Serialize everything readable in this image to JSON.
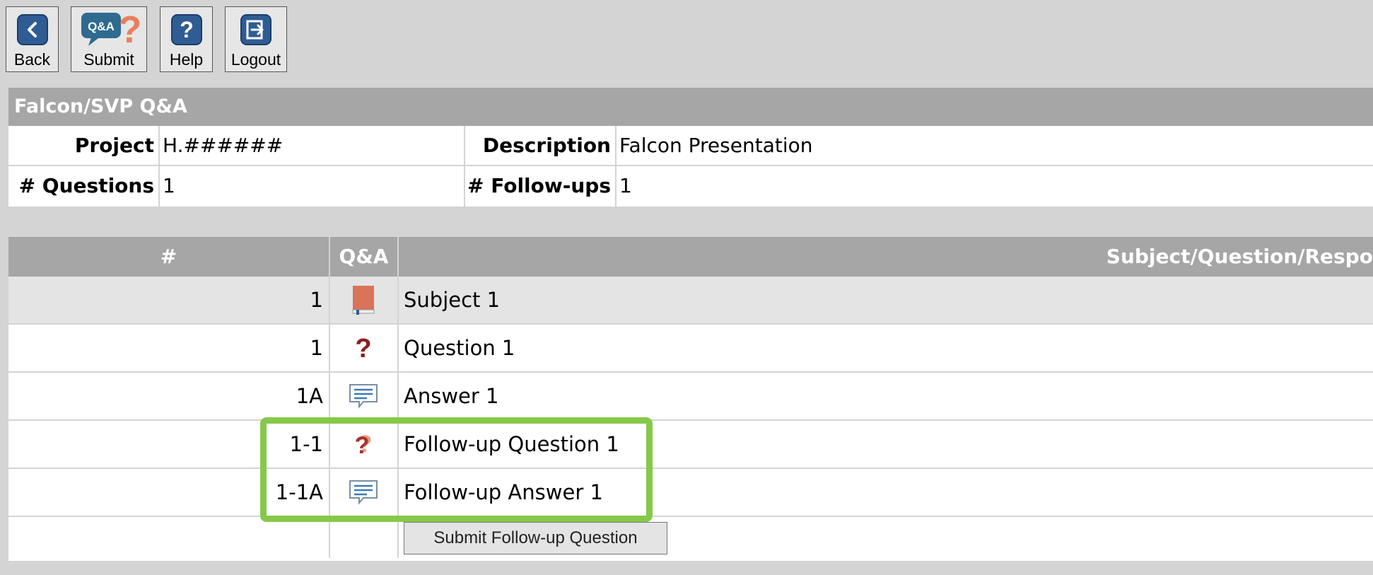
{
  "toolbar": {
    "back_label": "Back",
    "submit_label": "Submit",
    "submit_icon_text": "Q&A",
    "help_label": "Help",
    "logout_label": "Logout"
  },
  "section": {
    "title": "Falcon/SVP Q&A"
  },
  "info": {
    "project_label": "Project",
    "project_value": "H.######",
    "description_label": "Description",
    "description_value": "Falcon Presentation",
    "questions_label": "# Questions",
    "questions_value": "1",
    "followups_label": "# Follow-ups",
    "followups_value": "1"
  },
  "table": {
    "headers": {
      "num": "#",
      "qa": "Q&A",
      "text": "Subject/Question/Respo"
    },
    "rows": [
      {
        "num": "1",
        "icon": "book-icon",
        "text": "Subject 1"
      },
      {
        "num": "1",
        "icon": "question-mark-icon",
        "text": "Question 1"
      },
      {
        "num": "1A",
        "icon": "comment-icon",
        "text": "Answer 1"
      },
      {
        "num": "1-1",
        "icon": "followup-question-icon",
        "text": "Follow-up Question 1"
      },
      {
        "num": "1-1A",
        "icon": "comment-icon",
        "text": "Follow-up Answer 1"
      }
    ],
    "submit_followup_label": "Submit Follow-up Question"
  },
  "colors": {
    "header_gray": "#a6a6a6",
    "toolbar_bg": "#d4d4d4",
    "icon_blue": "#2f5c93",
    "highlight_green": "#86c94a",
    "book_red": "#d9735a",
    "question_red": "#8a1f1f"
  }
}
